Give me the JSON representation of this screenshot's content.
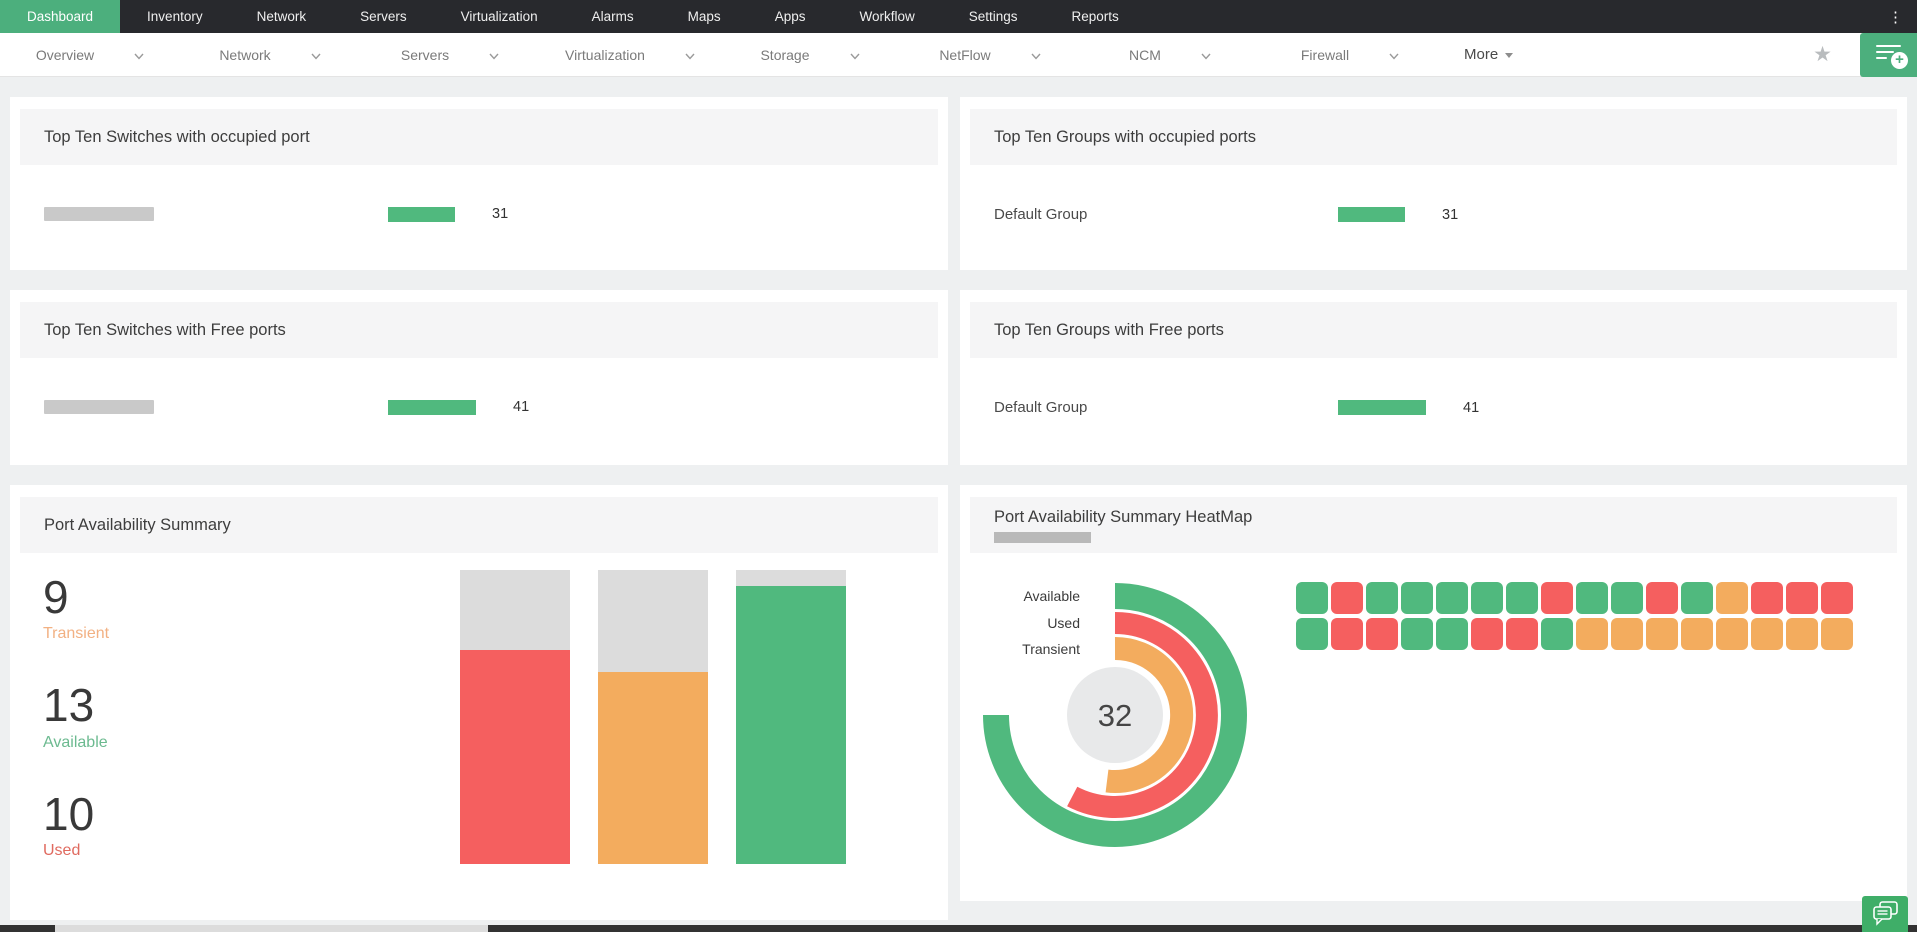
{
  "topnav": {
    "items": [
      {
        "label": "Dashboard",
        "active": true
      },
      {
        "label": "Inventory",
        "active": false
      },
      {
        "label": "Network",
        "active": false
      },
      {
        "label": "Servers",
        "active": false
      },
      {
        "label": "Virtualization",
        "active": false
      },
      {
        "label": "Alarms",
        "active": false
      },
      {
        "label": "Maps",
        "active": false
      },
      {
        "label": "Apps",
        "active": false
      },
      {
        "label": "Workflow",
        "active": false
      },
      {
        "label": "Settings",
        "active": false
      },
      {
        "label": "Reports",
        "active": false
      }
    ],
    "kebab_icon": "kebab-menu"
  },
  "subnav": {
    "tabs": [
      "Overview",
      "Network",
      "Servers",
      "Virtualization",
      "Storage",
      "NetFlow",
      "NCM",
      "Firewall"
    ],
    "more_label": "More",
    "star_icon": "favorite-star",
    "add_button_icon": "add-dashboard"
  },
  "colors": {
    "green": "#50b97e",
    "red": "#f55f5f",
    "orange": "#f3ac5e",
    "gray_rest": "#dcdcdc",
    "accent_nav": "#4caf7d"
  },
  "panels": {
    "switches_occupied": {
      "title": "Top Ten Switches with occupied port",
      "rows": [
        {
          "label": "",
          "redacted": true,
          "value": 31
        }
      ]
    },
    "groups_occupied": {
      "title": "Top Ten Groups with occupied ports",
      "rows": [
        {
          "label": "Default Group",
          "redacted": false,
          "value": 31
        }
      ]
    },
    "switches_free": {
      "title": "Top Ten Switches with Free ports",
      "rows": [
        {
          "label": "",
          "redacted": true,
          "value": 41
        }
      ]
    },
    "groups_free": {
      "title": "Top Ten Groups with Free ports",
      "rows": [
        {
          "label": "Default Group",
          "redacted": false,
          "value": 41
        }
      ]
    },
    "summary": {
      "title": "Port Availability Summary",
      "stats": [
        {
          "value": "9",
          "label": "Transient",
          "color": "#f2b183"
        },
        {
          "value": "13",
          "label": "Available",
          "color": "#6cba90"
        },
        {
          "value": "10",
          "label": "Used",
          "color": "#e06a5f"
        }
      ],
      "chart": {
        "type": "bar",
        "categories": [
          "Used",
          "Transient",
          "Available"
        ],
        "values": [
          10,
          9,
          13
        ],
        "colors": [
          "#f55f5f",
          "#f3ac5e",
          "#50b97e"
        ],
        "ylim": [
          0,
          13.75
        ],
        "remainder_color": "#dcdcdc"
      }
    },
    "heatmap": {
      "title": "Port Availability Summary HeatMap",
      "subtitle_redacted": true,
      "radial": {
        "type": "radial-bar",
        "center_total": "32",
        "max": 13,
        "sweep_deg": 270,
        "rings": [
          {
            "label": "Available",
            "value": 13,
            "color": "#50b97e"
          },
          {
            "label": "Used",
            "value": 10,
            "color": "#f55f5f"
          },
          {
            "label": "Transient",
            "value": 9,
            "color": "#f3ac5e"
          }
        ]
      },
      "grid": {
        "type": "heatmap",
        "legend": {
          "g": "#50b97e",
          "r": "#f55f5f",
          "o": "#f3ac5e"
        },
        "rows": [
          [
            "g",
            "r",
            "g",
            "g",
            "g",
            "g",
            "g",
            "r",
            "g",
            "g",
            "r",
            "g",
            "o",
            "r",
            "r",
            "r"
          ],
          [
            "g",
            "r",
            "r",
            "g",
            "g",
            "r",
            "r",
            "g",
            "o",
            "o",
            "o",
            "o",
            "o",
            "o",
            "o",
            "o"
          ]
        ]
      }
    }
  },
  "chat_button_icon": "chat-bubbles"
}
